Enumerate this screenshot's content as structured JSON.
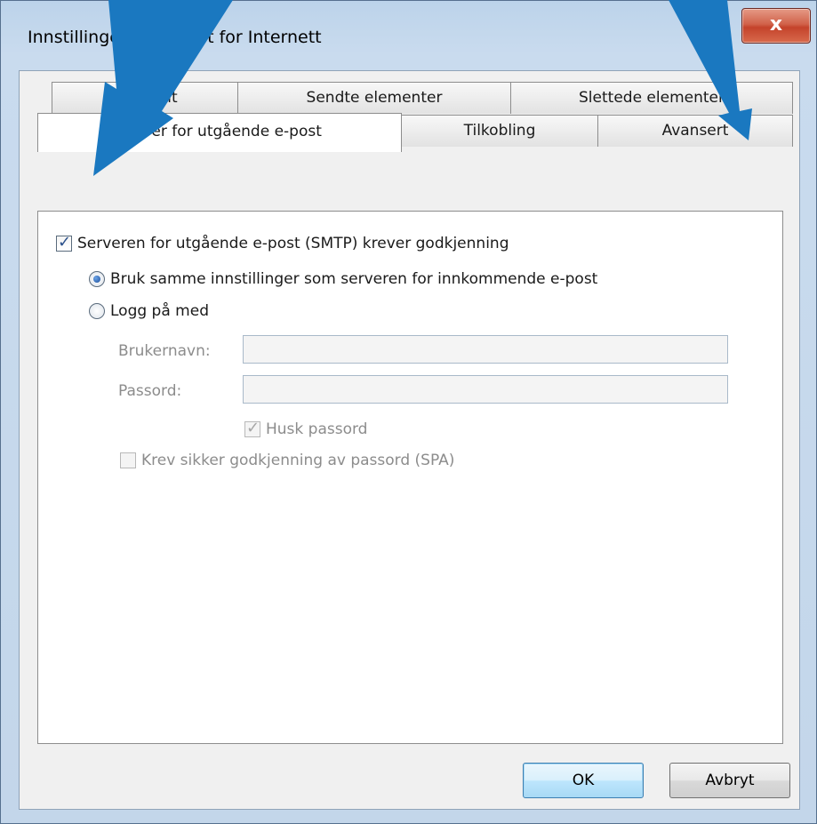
{
  "window": {
    "title": "Innstillinger for e-post for Internett",
    "close_label": "x"
  },
  "tabs": {
    "row1": [
      {
        "label": "Generelt"
      },
      {
        "label": "Sendte elementer"
      },
      {
        "label": "Slettede elementer"
      }
    ],
    "row2": [
      {
        "label": "Server for utgående e-post",
        "active": true
      },
      {
        "label": "Tilkobling"
      },
      {
        "label": "Avansert"
      }
    ]
  },
  "outgoing": {
    "smtp_auth_label": "Serveren for utgående e-post (SMTP) krever godkjenning",
    "smtp_auth_checked": true,
    "option_same_label": "Bruk samme innstillinger som serveren for innkommende e-post",
    "option_same_selected": true,
    "option_login_label": "Logg på med",
    "option_login_selected": false,
    "username_label": "Brukernavn:",
    "username_value": "",
    "password_label": "Passord:",
    "password_value": "",
    "remember_label": "Husk passord",
    "remember_checked": true,
    "spa_label": "Krev sikker godkjenning av passord (SPA)",
    "spa_checked": false
  },
  "buttons": {
    "ok": "OK",
    "cancel": "Avbryt"
  },
  "colors": {
    "annotation_arrow": "#1a78c0",
    "close_button": "#c4432b"
  }
}
